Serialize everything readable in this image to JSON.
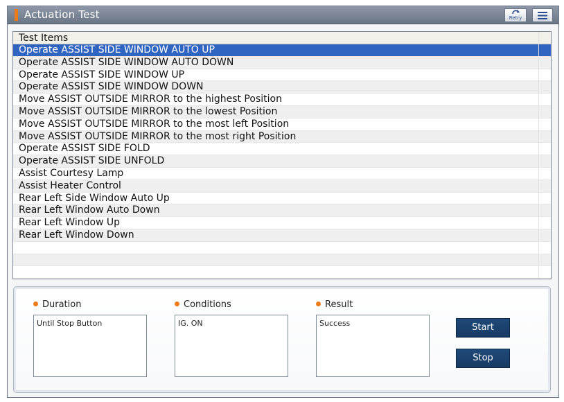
{
  "window": {
    "title": "Actuation Test",
    "retry_label": "Retry"
  },
  "list": {
    "header": "Test Items",
    "items": [
      "Operate ASSIST SIDE WINDOW AUTO UP",
      "Operate ASSIST SIDE WINDOW AUTO DOWN",
      "Operate ASSIST SIDE WINDOW UP",
      "Operate ASSIST SIDE WINDOW DOWN",
      "Move ASSIST OUTSIDE  MIRROR to the highest  Position",
      "Move ASSIST OUTSIDE  MIRROR to the lowest  Position",
      "Move ASSIST OUTSIDE  MIRROR to the most left  Position",
      "Move ASSIST OUTSIDE  MIRROR to the most right  Position",
      "Operate ASSIST SIDE  FOLD",
      "Operate ASSIST SIDE  UNFOLD",
      "Assist Courtesy Lamp",
      "Assist Heater Control",
      "Rear Left Side Window Auto Up",
      "Rear Left Window Auto Down",
      "Rear Left Window Up",
      "Rear Left Window Down"
    ],
    "selected_index": 0
  },
  "details": {
    "duration_label": "Duration",
    "duration_value": "Until Stop Button",
    "conditions_label": "Conditions",
    "conditions_value": "IG. ON",
    "result_label": "Result",
    "result_value": "Success"
  },
  "buttons": {
    "start": "Start",
    "stop": "Stop"
  },
  "colors": {
    "accent": "#f07a1a",
    "selection": "#2f64c0",
    "button": "#1f4a7a"
  }
}
